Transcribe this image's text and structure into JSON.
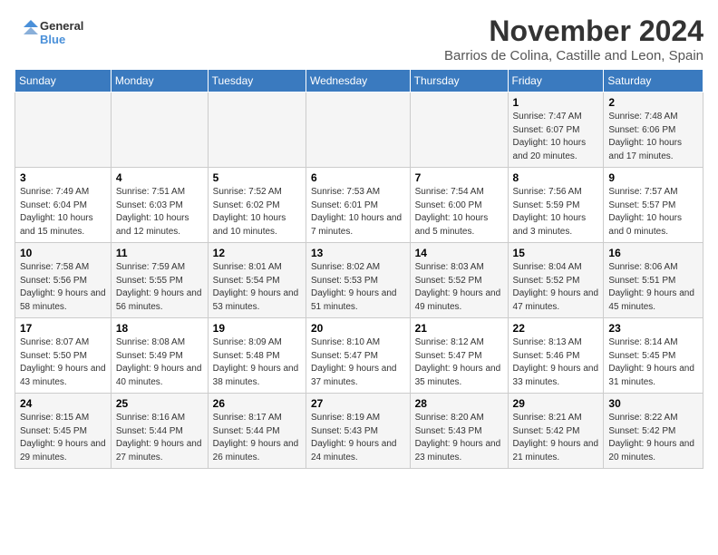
{
  "header": {
    "logo_general": "General",
    "logo_blue": "Blue",
    "title": "November 2024",
    "subtitle": "Barrios de Colina, Castille and Leon, Spain"
  },
  "weekdays": [
    "Sunday",
    "Monday",
    "Tuesday",
    "Wednesday",
    "Thursday",
    "Friday",
    "Saturday"
  ],
  "weeks": [
    [
      {
        "day": "",
        "info": ""
      },
      {
        "day": "",
        "info": ""
      },
      {
        "day": "",
        "info": ""
      },
      {
        "day": "",
        "info": ""
      },
      {
        "day": "",
        "info": ""
      },
      {
        "day": "1",
        "info": "Sunrise: 7:47 AM\nSunset: 6:07 PM\nDaylight: 10 hours and 20 minutes."
      },
      {
        "day": "2",
        "info": "Sunrise: 7:48 AM\nSunset: 6:06 PM\nDaylight: 10 hours and 17 minutes."
      }
    ],
    [
      {
        "day": "3",
        "info": "Sunrise: 7:49 AM\nSunset: 6:04 PM\nDaylight: 10 hours and 15 minutes."
      },
      {
        "day": "4",
        "info": "Sunrise: 7:51 AM\nSunset: 6:03 PM\nDaylight: 10 hours and 12 minutes."
      },
      {
        "day": "5",
        "info": "Sunrise: 7:52 AM\nSunset: 6:02 PM\nDaylight: 10 hours and 10 minutes."
      },
      {
        "day": "6",
        "info": "Sunrise: 7:53 AM\nSunset: 6:01 PM\nDaylight: 10 hours and 7 minutes."
      },
      {
        "day": "7",
        "info": "Sunrise: 7:54 AM\nSunset: 6:00 PM\nDaylight: 10 hours and 5 minutes."
      },
      {
        "day": "8",
        "info": "Sunrise: 7:56 AM\nSunset: 5:59 PM\nDaylight: 10 hours and 3 minutes."
      },
      {
        "day": "9",
        "info": "Sunrise: 7:57 AM\nSunset: 5:57 PM\nDaylight: 10 hours and 0 minutes."
      }
    ],
    [
      {
        "day": "10",
        "info": "Sunrise: 7:58 AM\nSunset: 5:56 PM\nDaylight: 9 hours and 58 minutes."
      },
      {
        "day": "11",
        "info": "Sunrise: 7:59 AM\nSunset: 5:55 PM\nDaylight: 9 hours and 56 minutes."
      },
      {
        "day": "12",
        "info": "Sunrise: 8:01 AM\nSunset: 5:54 PM\nDaylight: 9 hours and 53 minutes."
      },
      {
        "day": "13",
        "info": "Sunrise: 8:02 AM\nSunset: 5:53 PM\nDaylight: 9 hours and 51 minutes."
      },
      {
        "day": "14",
        "info": "Sunrise: 8:03 AM\nSunset: 5:52 PM\nDaylight: 9 hours and 49 minutes."
      },
      {
        "day": "15",
        "info": "Sunrise: 8:04 AM\nSunset: 5:52 PM\nDaylight: 9 hours and 47 minutes."
      },
      {
        "day": "16",
        "info": "Sunrise: 8:06 AM\nSunset: 5:51 PM\nDaylight: 9 hours and 45 minutes."
      }
    ],
    [
      {
        "day": "17",
        "info": "Sunrise: 8:07 AM\nSunset: 5:50 PM\nDaylight: 9 hours and 43 minutes."
      },
      {
        "day": "18",
        "info": "Sunrise: 8:08 AM\nSunset: 5:49 PM\nDaylight: 9 hours and 40 minutes."
      },
      {
        "day": "19",
        "info": "Sunrise: 8:09 AM\nSunset: 5:48 PM\nDaylight: 9 hours and 38 minutes."
      },
      {
        "day": "20",
        "info": "Sunrise: 8:10 AM\nSunset: 5:47 PM\nDaylight: 9 hours and 37 minutes."
      },
      {
        "day": "21",
        "info": "Sunrise: 8:12 AM\nSunset: 5:47 PM\nDaylight: 9 hours and 35 minutes."
      },
      {
        "day": "22",
        "info": "Sunrise: 8:13 AM\nSunset: 5:46 PM\nDaylight: 9 hours and 33 minutes."
      },
      {
        "day": "23",
        "info": "Sunrise: 8:14 AM\nSunset: 5:45 PM\nDaylight: 9 hours and 31 minutes."
      }
    ],
    [
      {
        "day": "24",
        "info": "Sunrise: 8:15 AM\nSunset: 5:45 PM\nDaylight: 9 hours and 29 minutes."
      },
      {
        "day": "25",
        "info": "Sunrise: 8:16 AM\nSunset: 5:44 PM\nDaylight: 9 hours and 27 minutes."
      },
      {
        "day": "26",
        "info": "Sunrise: 8:17 AM\nSunset: 5:44 PM\nDaylight: 9 hours and 26 minutes."
      },
      {
        "day": "27",
        "info": "Sunrise: 8:19 AM\nSunset: 5:43 PM\nDaylight: 9 hours and 24 minutes."
      },
      {
        "day": "28",
        "info": "Sunrise: 8:20 AM\nSunset: 5:43 PM\nDaylight: 9 hours and 23 minutes."
      },
      {
        "day": "29",
        "info": "Sunrise: 8:21 AM\nSunset: 5:42 PM\nDaylight: 9 hours and 21 minutes."
      },
      {
        "day": "30",
        "info": "Sunrise: 8:22 AM\nSunset: 5:42 PM\nDaylight: 9 hours and 20 minutes."
      }
    ]
  ]
}
